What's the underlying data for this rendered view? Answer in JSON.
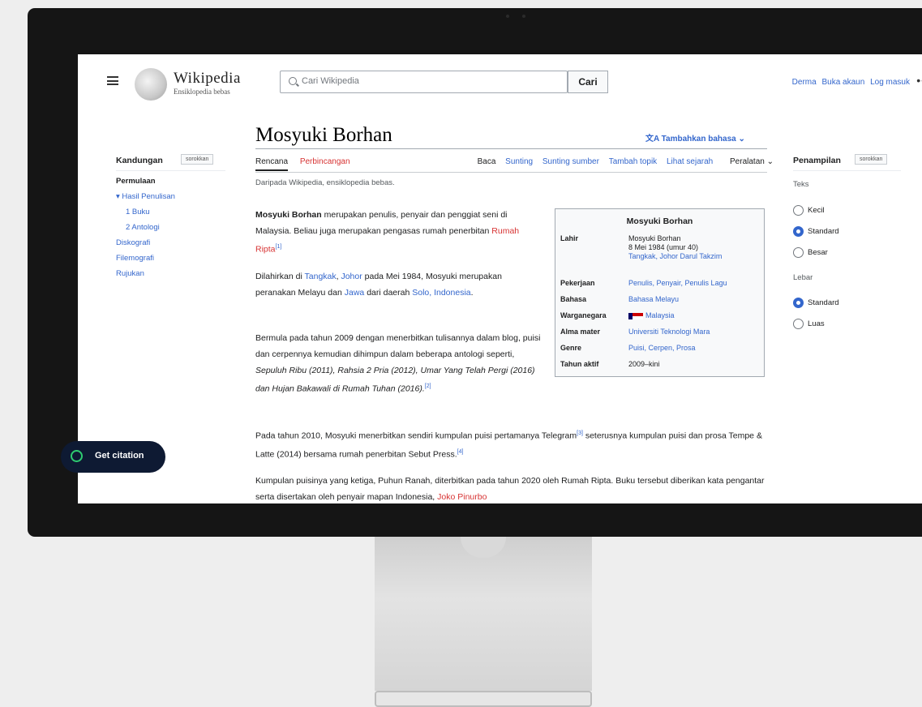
{
  "header": {
    "wordmark": "Wikipedia",
    "tagline": "Ensiklopedia bebas",
    "search_placeholder": "Cari Wikipedia",
    "search_button": "Cari",
    "nav": [
      "Derma",
      "Buka akaun",
      "Log masuk"
    ],
    "more": "•••"
  },
  "article": {
    "title": "Mosyuki Borhan",
    "language_button": "Tambahkan bahasa",
    "tabs_left": [
      "Rencana",
      "Perbincangan"
    ],
    "tabs_right": [
      "Baca",
      "Sunting",
      "Sunting sumber",
      "Tambah topik",
      "Lihat sejarah",
      "Peralatan"
    ],
    "from": "Daripada Wikipedia, ensiklopedia bebas.",
    "p1_name": "Mosyuki Borhan",
    "p1_text": "merupakan penulis, penyair dan penggiat seni di Malaysia. Beliau juga merupakan pengasas rumah penerbitan",
    "p1_link": "Rumah Ripta",
    "p1_ref": "[1]",
    "p2_text": "Dilahirkan di",
    "p2_link1": "Tangkak",
    "p2_link2": "Johor",
    "p2_text2": "pada Mei 1984, Mosyuki merupakan peranakan Melayu dan",
    "p2_link3": "Jawa",
    "p2_text3": "dari daerah",
    "p2_link4": "Solo, Indonesia",
    "p3_text": "Bermula pada tahun 2009 dengan menerbitkan tulisannya dalam blog, puisi dan cerpennya kemudian dihimpun dalam beberapa antologi seperti,",
    "p3_works": "Sepuluh Ribu (2011), Rahsia 2 Pria (2012), Umar Yang Telah Pergi (2016) dan Hujan Bakawali di Rumah Tuhan (2016).",
    "p3_ref": "[2]",
    "p4_text": "Pada tahun 2010, Mosyuki menerbitkan sendiri kumpulan puisi pertamanya Telegram",
    "p4_ref": "[3]",
    "p4_text2": "seterusnya kumpulan puisi dan prosa Tempe & Latte (2014) bersama rumah penerbitan Sebut Press.",
    "p4_ref2": "[4]",
    "p5_text": "Kumpulan puisinya yang ketiga, Puhun Ranah, diterbitkan pada tahun 2020 oleh Rumah Ripta. Buku",
    "p5_text2": "tersebut diberikan kata pengantar serta disertakan oleh penyair mapan Indonesia,",
    "p5_link": "Joko Pinurbo"
  },
  "toc": {
    "heading": "Kandungan",
    "hide": "sorokkan",
    "items": [
      "Permulaan",
      "Hasil Penulisan",
      "1 Buku",
      "2 Antologi",
      "Diskografi",
      "Filemografi",
      "Rujukan"
    ]
  },
  "appearance": {
    "heading": "Penampilan",
    "hide": "sorokkan",
    "text_label": "Teks",
    "text_options": [
      "Kecil",
      "Standard",
      "Besar"
    ],
    "text_selected": "Standard",
    "width_label": "Lebar",
    "width_options": [
      "Standard",
      "Luas"
    ],
    "width_selected": "Standard"
  },
  "infobox": {
    "title": "Mosyuki Borhan",
    "born_label": "Lahir",
    "born_name": "Mosyuki Borhan",
    "born_date": "8 Mei 1984 (umur 40)",
    "born_place": "Tangkak, Johor Darul Takzim",
    "occupation_label": "Pekerjaan",
    "occupation": "Penulis, Penyair, Penulis Lagu",
    "language_label": "Bahasa",
    "language": "Bahasa Melayu",
    "citizenship_label": "Warganegara",
    "citizenship": "Malaysia",
    "alma_label": "Alma mater",
    "alma": "Universiti Teknologi Mara",
    "genre_label": "Genre",
    "genre": "Puisi, Cerpen, Prosa",
    "active_label": "Tahun aktif",
    "active": "2009–kini"
  },
  "citation": {
    "label": "Get citation"
  },
  "colors": {
    "link": "#3366cc",
    "redlink": "#d73333",
    "bezel": "#151515",
    "pill": "#0e1a33"
  }
}
